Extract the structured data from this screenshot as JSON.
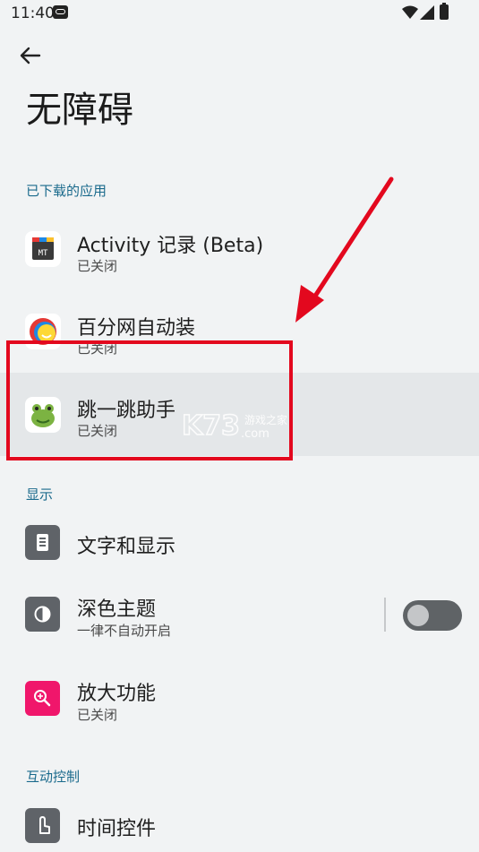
{
  "status_bar": {
    "time": "11:40"
  },
  "page": {
    "title": "无障碍"
  },
  "sections": {
    "downloaded_apps": "已下载的应用",
    "display": "显示",
    "interaction": "互动控制"
  },
  "apps": [
    {
      "title": "Activity 记录 (Beta)",
      "status": "已关闭"
    },
    {
      "title": "百分网自动装",
      "status": "已关闭"
    },
    {
      "title": "跳一跳助手",
      "status": "已关闭"
    }
  ],
  "display_items": [
    {
      "title": "文字和显示"
    },
    {
      "title": "深色主题",
      "subtitle": "一律不自动开启",
      "toggle_on": false
    },
    {
      "title": "放大功能",
      "status": "已关闭"
    }
  ],
  "interaction_items": [
    {
      "title": "时间控件"
    }
  ],
  "watermark": {
    "brand": "K73",
    "cn": "游戏之家",
    "domain": ".com"
  },
  "colors": {
    "accent": "#1a6a8c",
    "annotation": "#e3081e",
    "magnify": "#f0166b"
  }
}
